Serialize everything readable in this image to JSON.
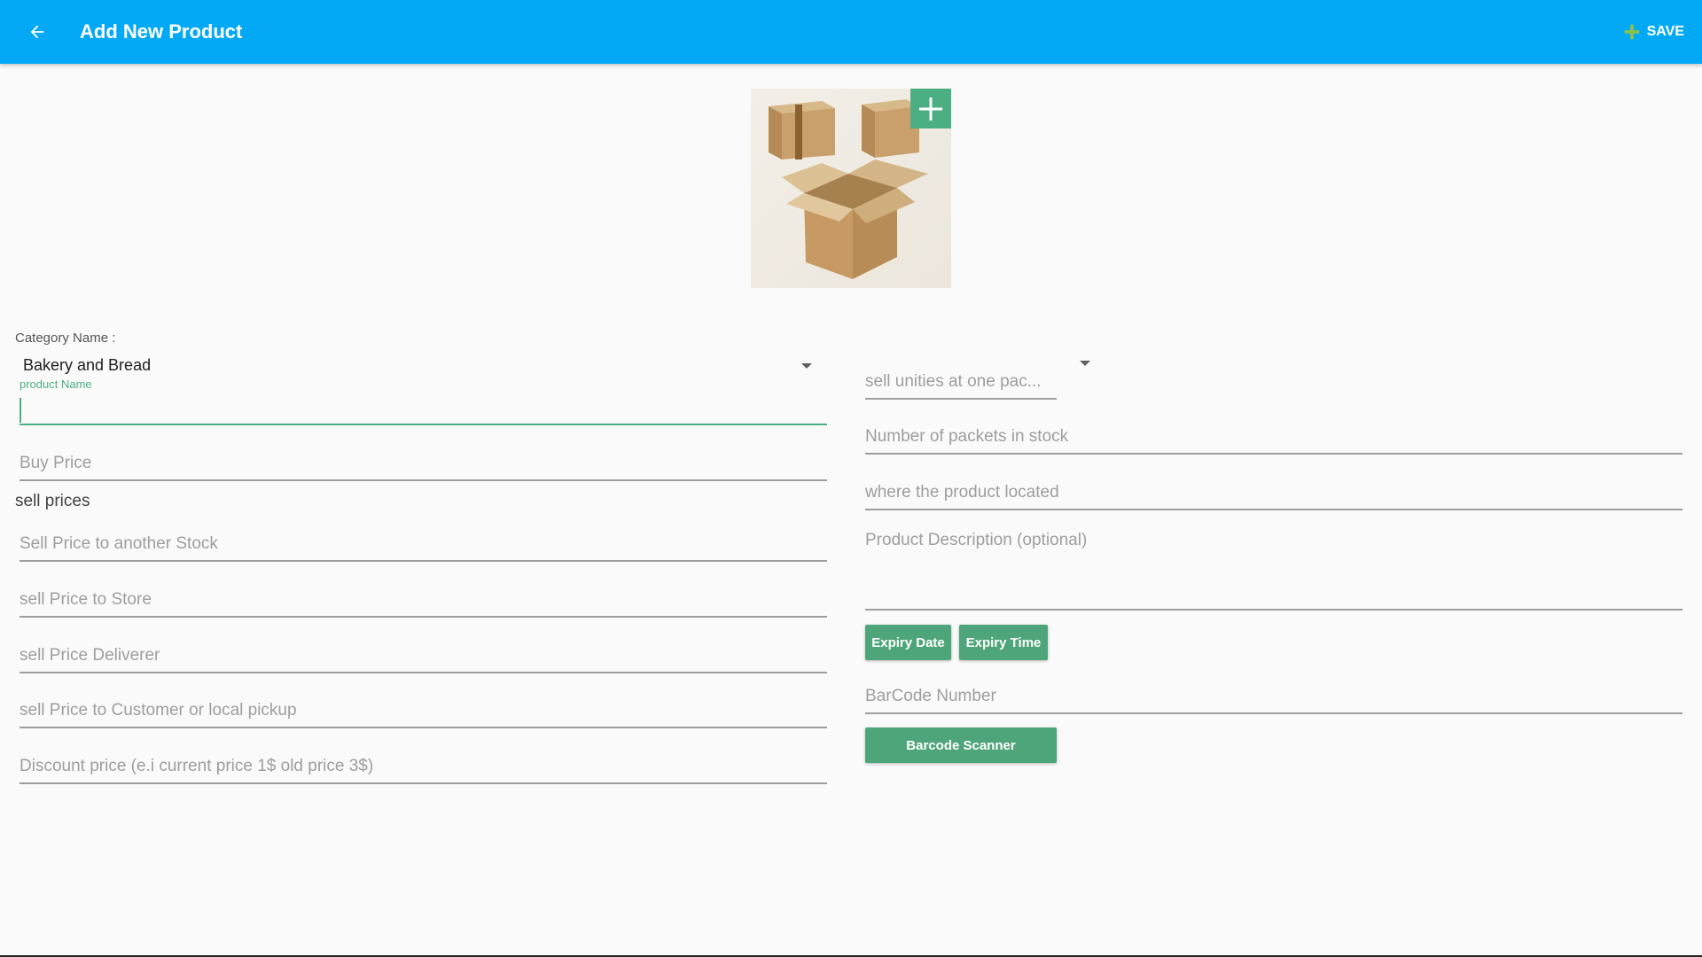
{
  "appbar": {
    "title": "Add New Product",
    "save_label": "SAVE"
  },
  "product_image": {
    "image_icon": "cardboard-boxes-image",
    "add_icon": "plus-icon"
  },
  "form": {
    "category": {
      "label": "Category Name :",
      "selected": "Bakery and Bread"
    },
    "product_name": {
      "float_label": "product Name",
      "value": ""
    },
    "buy_price": {
      "placeholder": "Buy Price"
    },
    "sell_prices_heading": "sell prices",
    "sell_price_stock": {
      "placeholder": "Sell Price to another Stock"
    },
    "sell_price_store": {
      "placeholder": "sell Price to Store"
    },
    "sell_price_deliverer": {
      "placeholder": "sell Price Deliverer"
    },
    "sell_price_customer": {
      "placeholder": "sell Price to Customer or local pickup"
    },
    "discount_price": {
      "placeholder": "Discount price (e.i current price 1$ old price 3$)"
    },
    "unities_spinner": {
      "placeholder": "sell unities at one pac..."
    },
    "packets_in_stock": {
      "placeholder": "Number of packets in stock"
    },
    "location": {
      "placeholder": "where the product located"
    },
    "description": {
      "placeholder": "Product Description (optional)"
    },
    "expiry_date_label": "Expiry Date",
    "expiry_time_label": "Expiry Time",
    "barcode": {
      "placeholder": "BarCode Number"
    },
    "barcode_scanner_label": "Barcode Scanner"
  },
  "colors": {
    "appbar": "#03a9f4",
    "accent": "#4caf84",
    "save_plus": "#8bc34a"
  }
}
